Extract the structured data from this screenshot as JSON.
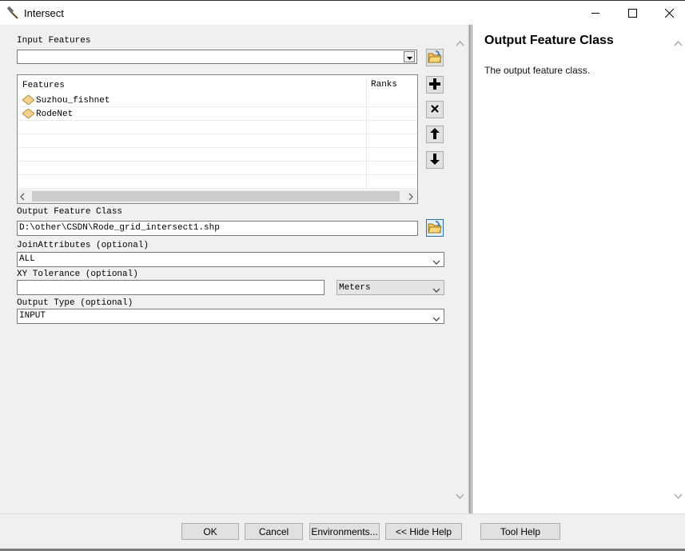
{
  "window": {
    "title": "Intersect",
    "app_icon": "hammer-icon",
    "minimize_icon": "minimize-icon",
    "maximize_icon": "maximize-icon",
    "close_icon": "close-icon"
  },
  "form": {
    "input_features": {
      "label": "Input Features",
      "value": "",
      "browse_icon": "folder-open-icon"
    },
    "features_table": {
      "columns": [
        "Features",
        "Ranks"
      ],
      "rows": [
        {
          "feature": "Suzhou_fishnet",
          "rank": "",
          "icon": "polygon-layer-icon"
        },
        {
          "feature": "RodeNet",
          "rank": "",
          "icon": "polygon-layer-icon"
        }
      ],
      "side_buttons": [
        "add-icon",
        "remove-icon",
        "move-up-icon",
        "move-down-icon"
      ]
    },
    "output_feature_class": {
      "label": "Output Feature Class",
      "value": "D:\\other\\CSDN\\Rode_grid_intersect1.shp",
      "browse_icon": "folder-open-icon"
    },
    "join_attributes": {
      "label": "JoinAttributes (optional)",
      "value": "ALL"
    },
    "xy_tolerance": {
      "label": "XY Tolerance (optional)",
      "value": "",
      "unit": "Meters"
    },
    "output_type": {
      "label": "Output Type (optional)",
      "value": "INPUT"
    }
  },
  "help": {
    "title": "Output Feature Class",
    "text": "The output feature class."
  },
  "buttons": {
    "ok": "OK",
    "cancel": "Cancel",
    "environments": "Environments...",
    "hide_help": "<< Hide Help",
    "tool_help": "Tool Help"
  },
  "colors": {
    "window_bg": "#f0f0f0",
    "field_border": "#7a7a7a",
    "folder_yellow": "#f5c65b",
    "accent_blue": "#2a6ebd",
    "layer_icon_fill": "#f2d28b"
  }
}
